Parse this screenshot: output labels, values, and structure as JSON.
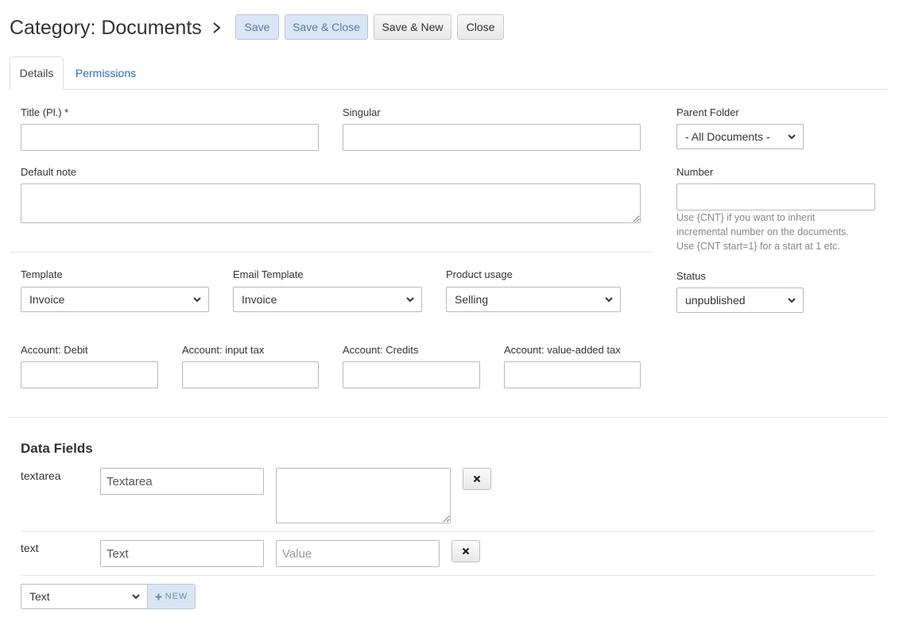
{
  "header": {
    "title": "Category: Documents",
    "buttons": {
      "save": "Save",
      "save_close": "Save & Close",
      "save_new": "Save & New",
      "close": "Close"
    }
  },
  "tabs": [
    {
      "label": "Details",
      "active": true
    },
    {
      "label": "Permissions",
      "active": false
    }
  ],
  "form": {
    "title_label": "Title (Pl.) *",
    "title_value": "",
    "singular_label": "Singular",
    "singular_value": "",
    "default_note_label": "Default note",
    "default_note_value": "",
    "parent_folder_label": "Parent Folder",
    "parent_folder_value": "- All Documents -",
    "number_label": "Number",
    "number_value": "",
    "number_hint": [
      "Use {CNT} if you want to inherit",
      "incremental number on the documents.",
      "Use {CNT start=1} for a start at 1 etc."
    ],
    "template_label": "Template",
    "template_value": "Invoice",
    "email_template_label": "Email Template",
    "email_template_value": "Invoice",
    "product_usage_label": "Product usage",
    "product_usage_value": "Selling",
    "status_label": "Status",
    "status_value": "unpublished",
    "account_debit_label": "Account: Debit",
    "account_input_tax_label": "Account: input tax",
    "account_credits_label": "Account: Credits",
    "account_vat_label": "Account: value-added tax"
  },
  "data_fields": {
    "title": "Data Fields",
    "rows": [
      {
        "type": "textarea",
        "name_value": "Textarea",
        "value_placeholder": ""
      },
      {
        "type": "text",
        "name_value": "Text",
        "value_placeholder": "Value"
      }
    ],
    "new_type_value": "Text",
    "new_label": "NEW",
    "new_icon": "plus-icon"
  },
  "colors": {
    "primary_button_bg": "#dbe6f4",
    "link": "#2a6ebb",
    "border": "#b9b9b9"
  }
}
